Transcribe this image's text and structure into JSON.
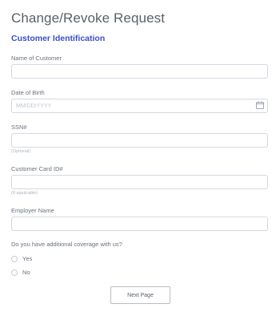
{
  "form": {
    "title": "Change/Revoke Request",
    "section_title": "Customer Identification"
  },
  "fields": {
    "customer_name": {
      "label": "Name of Customer",
      "value": ""
    },
    "date_of_birth": {
      "label": "Date of Birth",
      "placeholder": "MM/DD/YYYY",
      "icon": "calendar-icon"
    },
    "ssn": {
      "label": "SSN#",
      "sublabel": "(Optional)"
    },
    "card_id": {
      "label": "Customer Card ID#",
      "sublabel": "(If applicable)"
    },
    "employer": {
      "label": "Employer Name"
    }
  },
  "coverage_question": {
    "label": "Do you have additional coverage with us?",
    "options": [
      "Yes",
      "No"
    ],
    "selected": null
  },
  "actions": {
    "next_label": "Next Page"
  },
  "colors": {
    "accent": "#3c4ec9",
    "border": "#d4d8e0",
    "text": "#6a7180"
  }
}
